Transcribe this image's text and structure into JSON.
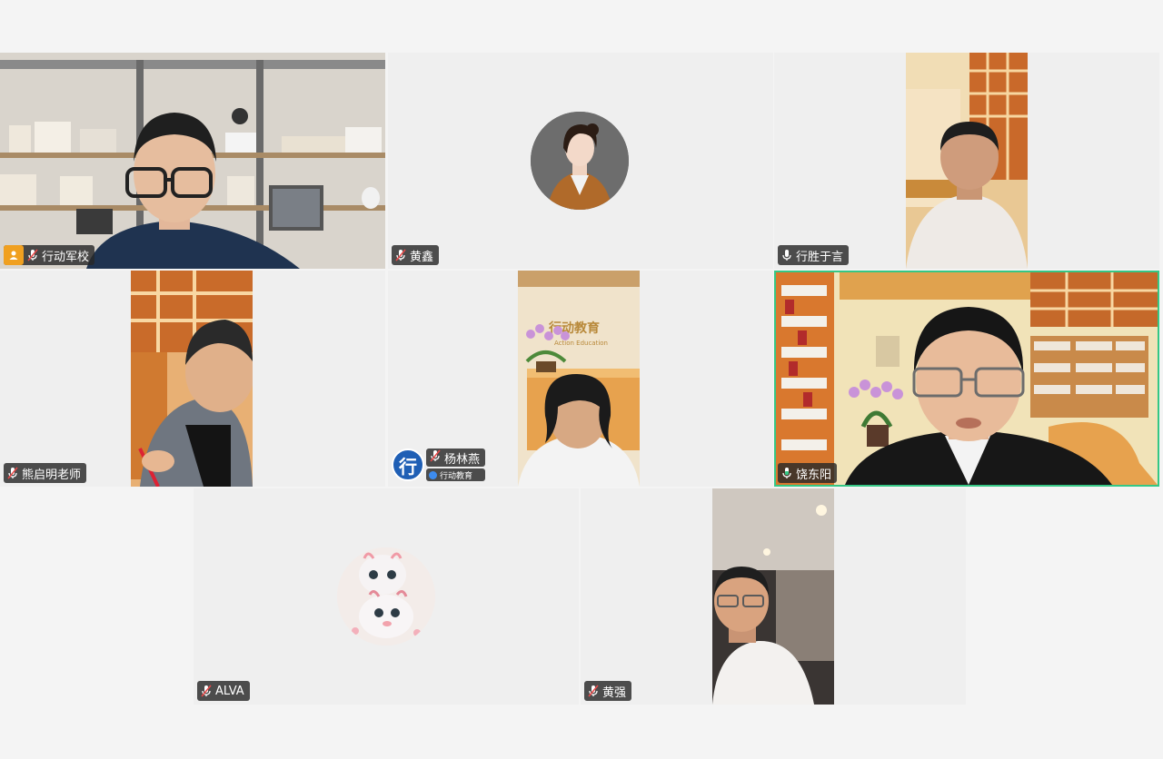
{
  "participants": [
    {
      "name": "行动军校",
      "mic": "muted",
      "host": true
    },
    {
      "name": "黄鑫",
      "mic": "muted"
    },
    {
      "name": "行胜于言",
      "mic": "on"
    },
    {
      "name": "熊启明老师",
      "mic": "muted"
    },
    {
      "name": "杨林燕",
      "mic": "muted",
      "org": "行动教育",
      "org_logo": "行"
    },
    {
      "name": "饶东阳",
      "mic": "speaking",
      "active_speaker": true
    },
    {
      "name": "ALVA",
      "mic": "muted"
    },
    {
      "name": "黄强",
      "mic": "muted"
    }
  ],
  "background_sign": "Action Education",
  "colors": {
    "active_border": "#35c785",
    "tile_bg": "#efefef",
    "host_badge": "#f0a020",
    "label_bg": "#282828"
  }
}
